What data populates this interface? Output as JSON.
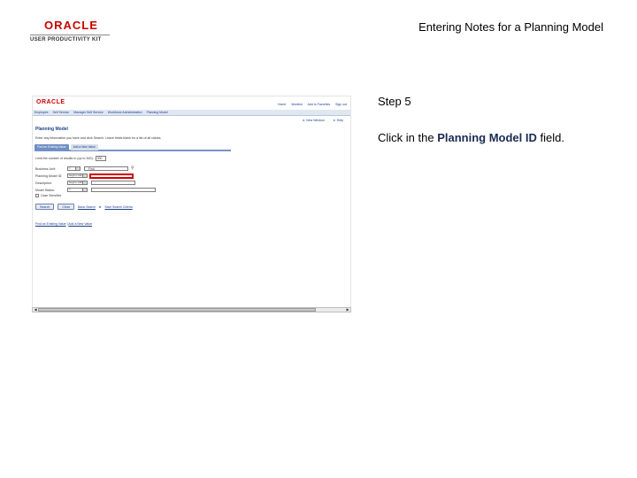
{
  "header": {
    "brand": "ORACLE",
    "product": "USER PRODUCTIVITY KIT",
    "title": "Entering Notes for a Planning Model"
  },
  "screenshot": {
    "brand": "ORACLE",
    "topnav": [
      "Home",
      "Worklist",
      "Add to Favorites",
      "Sign out"
    ],
    "menu": [
      "Employee",
      "Self Service",
      "Manager Self Service",
      "Workforce Administration",
      "Planning Model"
    ],
    "toolbar": [
      "New Window",
      "Help"
    ],
    "component_title": "Planning Model",
    "instructions": "Enter any information you have and click Search. Leave fields blank for a list of all values.",
    "tabs": [
      "Find an Existing Value",
      "Add a New Value"
    ],
    "limit_label": "Limit the number of results to (up to 300):",
    "limit_value": "300",
    "fields": {
      "business_unit": {
        "label": "Business Unit:",
        "op": "=",
        "lookup_label": "Find"
      },
      "planning_model_id": {
        "label": "Planning Model ID:",
        "op": "begins with"
      },
      "description": {
        "label": "Description:",
        "op": "begins with"
      },
      "model_status": {
        "label": "Model Status:",
        "op": "="
      }
    },
    "case_sensitive": "Case Sensitive",
    "search_button": "Search",
    "clear_button": "Clear",
    "basic_search_link": "Basic Search",
    "save_criteria_link": "Save Search Criteria",
    "bottom_links": {
      "find_value": "Find an Existing Value",
      "add_value": "Add a New Value"
    }
  },
  "step": {
    "label": "Step 5",
    "instruction_prefix": "Click in the ",
    "instruction_target": "Planning Model ID",
    "instruction_suffix": " field."
  },
  "colors": {
    "highlight": "#d10000",
    "link": "#1a3e8a",
    "brand": "#cc0000"
  }
}
